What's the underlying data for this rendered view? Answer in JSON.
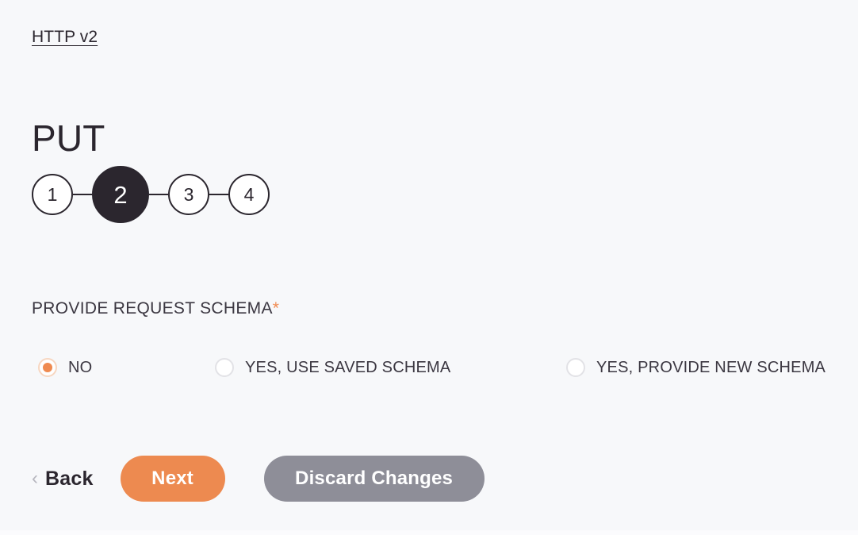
{
  "theme": {
    "background": "#f7f8fa",
    "text_dark": "#2b262e",
    "accent_orange": "#ed8a50",
    "radio_selected": "#ef8a50",
    "secondary_gray": "#8e8e98",
    "step_border": "#2b262e"
  },
  "breadcrumb": {
    "label": "HTTP v2"
  },
  "header": {
    "title": "PUT"
  },
  "stepper": {
    "current": 2,
    "steps": [
      {
        "number": "1",
        "active": false
      },
      {
        "number": "2",
        "active": true
      },
      {
        "number": "3",
        "active": false
      },
      {
        "number": "4",
        "active": false
      }
    ]
  },
  "form": {
    "field": {
      "label": "PROVIDE REQUEST SCHEMA",
      "required_mark": "*",
      "required": true,
      "selected_value": "NO",
      "options": [
        {
          "label": "NO",
          "selected": true
        },
        {
          "label": "YES, USE SAVED SCHEMA",
          "selected": false
        },
        {
          "label": "YES, PROVIDE NEW SCHEMA",
          "selected": false
        }
      ]
    }
  },
  "actions": {
    "back_icon": "chevron-left-icon",
    "back_label": "Back",
    "next_label": "Next",
    "discard_label": "Discard Changes"
  }
}
